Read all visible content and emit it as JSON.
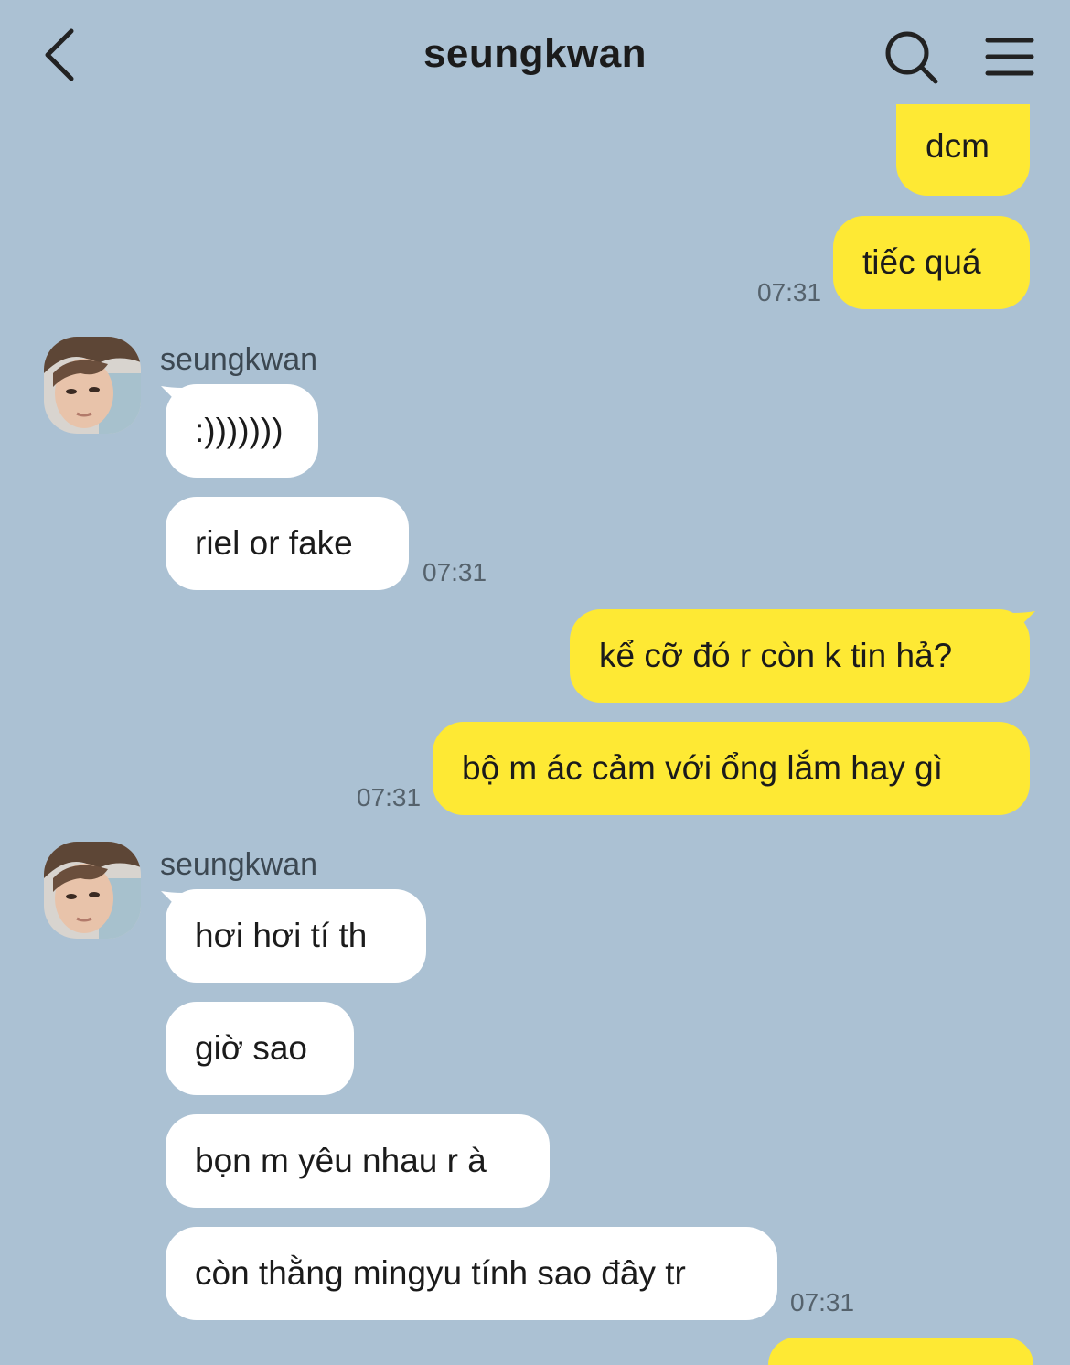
{
  "header": {
    "title": "seungkwan",
    "back_icon": "chevron-left-icon",
    "search_icon": "search-icon",
    "menu_icon": "hamburger-menu-icon"
  },
  "colors": {
    "background": "#abc1d3",
    "outgoing_bubble": "#fee934",
    "incoming_bubble": "#ffffff"
  },
  "messages": {
    "m1": "dcm",
    "m2": "tiếc quá",
    "m2_time": "07:31",
    "group1_sender": "seungkwan",
    "m3": ":)))))))",
    "m4": "riel or fake",
    "m4_time": "07:31",
    "m5": "kể cỡ đó r còn k tin hả?",
    "m6": "bộ m ác cảm với ổng lắm hay gì",
    "m6_time": "07:31",
    "group2_sender": "seungkwan",
    "m7": "hơi hơi tí th",
    "m8": "giờ sao",
    "m9": "bọn m yêu nhau r à",
    "m10": "còn thằng mingyu tính sao đây tr",
    "m10_time": "07:31"
  }
}
